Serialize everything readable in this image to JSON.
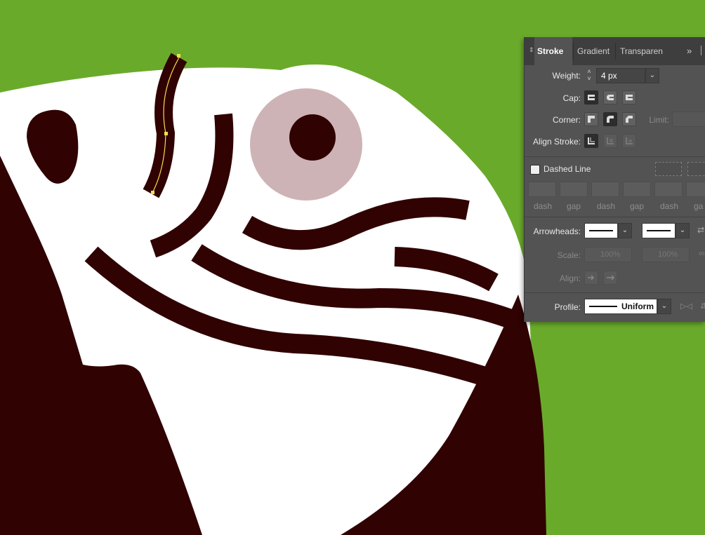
{
  "colors": {
    "background": "#6aaa2b",
    "head": "#ffffff",
    "dark": "#300202",
    "eye_ring": "#ceb3b6",
    "selection": "#f5e04a"
  },
  "panel": {
    "tabs": [
      {
        "label": "Stroke",
        "active": true
      },
      {
        "label": "Gradient",
        "active": false
      },
      {
        "label": "Transparen",
        "active": false
      }
    ],
    "expand_icon": "double-chevron-icon",
    "weight": {
      "label": "Weight:",
      "value": "4 px"
    },
    "cap": {
      "label": "Cap:"
    },
    "corner": {
      "label": "Corner:",
      "limit_label": "Limit:"
    },
    "align_stroke": {
      "label": "Align Stroke:"
    },
    "dashed_line": {
      "label": "Dashed Line",
      "checked": false
    },
    "dash_labels": [
      "dash",
      "gap",
      "dash",
      "gap",
      "dash",
      "ga"
    ],
    "arrowheads": {
      "label": "Arrowheads:"
    },
    "scale": {
      "label": "Scale:",
      "start": "100%",
      "end": "100%"
    },
    "align": {
      "label": "Align:"
    },
    "profile": {
      "label": "Profile:",
      "value": "Uniform"
    }
  }
}
